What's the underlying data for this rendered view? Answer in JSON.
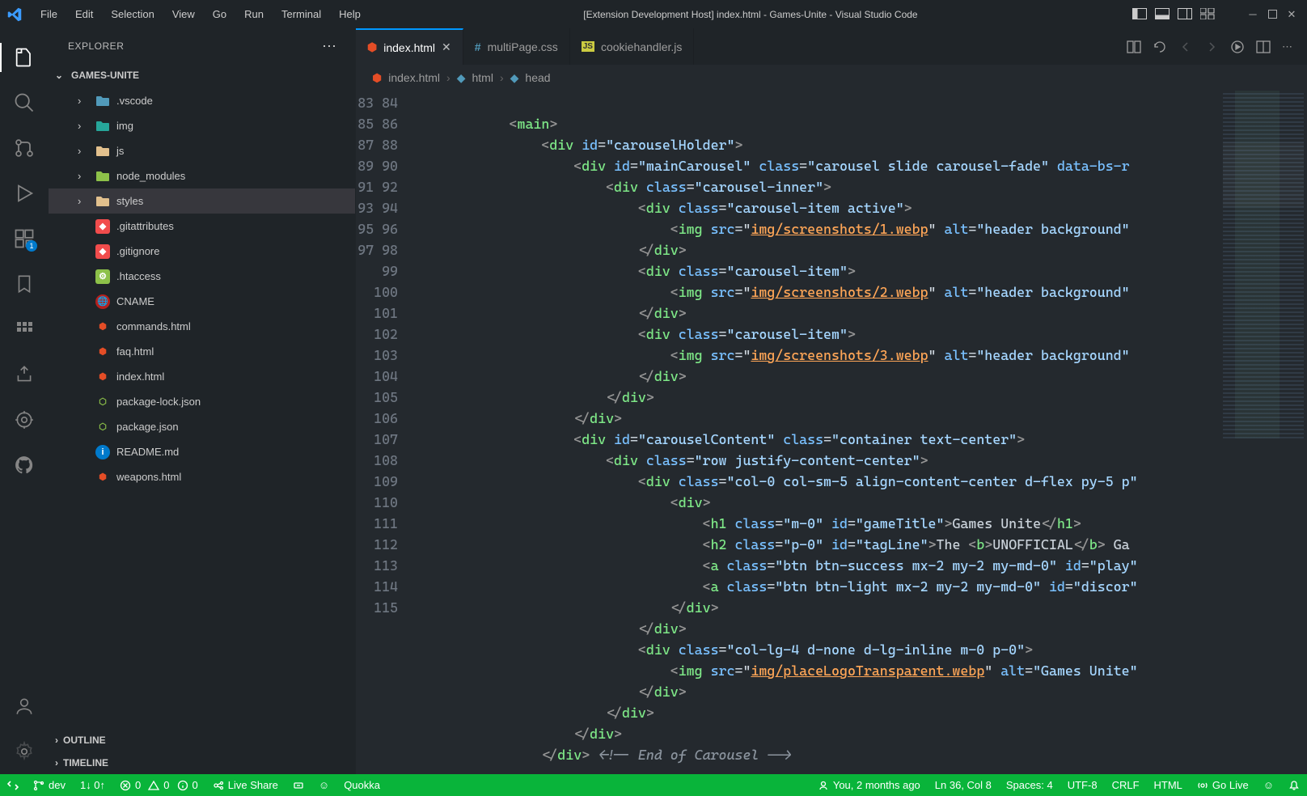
{
  "title": "[Extension Development Host] index.html - Games-Unite - Visual Studio Code",
  "menubar": [
    "File",
    "Edit",
    "Selection",
    "View",
    "Go",
    "Run",
    "Terminal",
    "Help"
  ],
  "sidebar": {
    "title": "EXPLORER",
    "project": "GAMES-UNITE",
    "outline": "OUTLINE",
    "timeline": "TIMELINE",
    "tree": [
      {
        "name": ".vscode",
        "type": "folder",
        "icon": "folder-blue"
      },
      {
        "name": "img",
        "type": "folder",
        "icon": "folder-teal"
      },
      {
        "name": "js",
        "type": "folder",
        "icon": "folder-yellow"
      },
      {
        "name": "node_modules",
        "type": "folder",
        "icon": "folder-green"
      },
      {
        "name": "styles",
        "type": "folder",
        "icon": "folder-yellow",
        "selected": true
      },
      {
        "name": ".gitattributes",
        "type": "file",
        "icon": "git"
      },
      {
        "name": ".gitignore",
        "type": "file",
        "icon": "git"
      },
      {
        "name": ".htaccess",
        "type": "file",
        "icon": "config"
      },
      {
        "name": "CNAME",
        "type": "file",
        "icon": "globe"
      },
      {
        "name": "commands.html",
        "type": "file",
        "icon": "html"
      },
      {
        "name": "faq.html",
        "type": "file",
        "icon": "html"
      },
      {
        "name": "index.html",
        "type": "file",
        "icon": "html"
      },
      {
        "name": "package-lock.json",
        "type": "file",
        "icon": "node"
      },
      {
        "name": "package.json",
        "type": "file",
        "icon": "node"
      },
      {
        "name": "README.md",
        "type": "file",
        "icon": "info"
      },
      {
        "name": "weapons.html",
        "type": "file",
        "icon": "html"
      }
    ]
  },
  "tabs": [
    {
      "label": "index.html",
      "icon": "html",
      "active": true,
      "dirty": false
    },
    {
      "label": "multiPage.css",
      "icon": "css",
      "active": false
    },
    {
      "label": "cookiehandler.js",
      "icon": "js",
      "active": false
    }
  ],
  "breadcrumb": [
    "index.html",
    "html",
    "head"
  ],
  "line_start": 83,
  "line_end": 114,
  "statusbar": {
    "branch": "dev",
    "sync": "1↓ 0↑",
    "errors": "0",
    "warnings": "0",
    "info": "0",
    "liveshare": "Live Share",
    "quokka": "Quokka",
    "blame": "You, 2 months ago",
    "cursor": "Ln 36, Col 8",
    "spaces": "Spaces: 4",
    "encoding": "UTF-8",
    "eol": "CRLF",
    "lang": "HTML",
    "golive": "Go Live"
  }
}
